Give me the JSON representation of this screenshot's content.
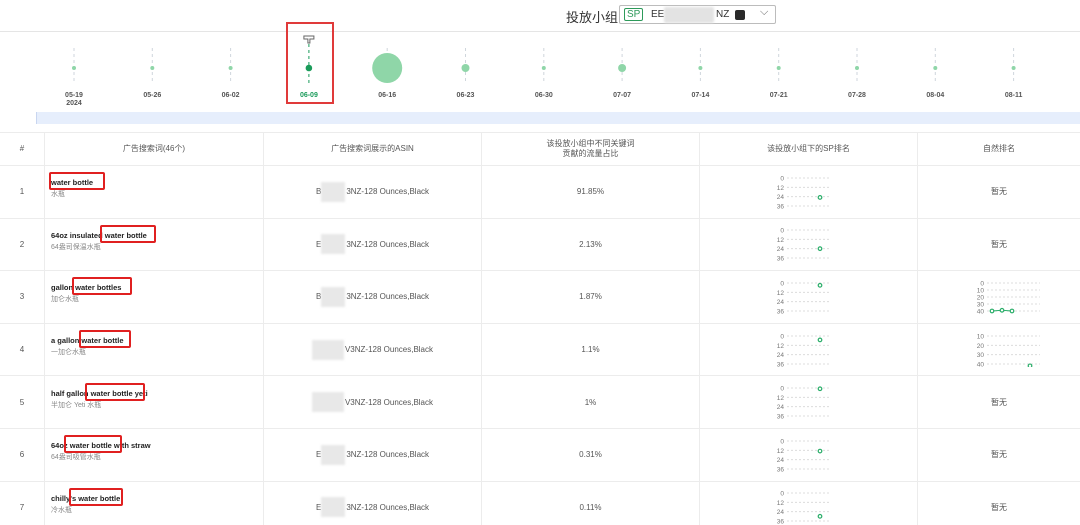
{
  "header": {
    "group_label": "投放小组",
    "badge": "SP",
    "group_name_prefix": "EE",
    "group_name_suffix": "NZ"
  },
  "timeline": {
    "dates": [
      "05-19",
      "05-26",
      "06-02",
      "06-09",
      "06-16",
      "06-23",
      "06-30",
      "07-07",
      "07-14",
      "07-21",
      "07-28",
      "08-04",
      "08-11"
    ],
    "year_label": "2024",
    "selected_index": 3,
    "selected_color": "#1a9b5a",
    "bubble_color": "#8fd6a8",
    "bubble_sizes": [
      1,
      0,
      0,
      2,
      12,
      3,
      1,
      3,
      0,
      1,
      1,
      1,
      1
    ]
  },
  "table": {
    "headers": {
      "index": "#",
      "keyword": "广告搜索词(46个)",
      "asin": "广告搜索词展示的ASIN",
      "traffic": "该投放小组中不同关键词\n贡献的流量占比",
      "sp_rank": "该投放小组下的SP排名",
      "natural_rank": "自然排名"
    },
    "rows": [
      {
        "index": "1",
        "keyword": "water bottle",
        "translation": "水瓶",
        "asin_prefix": "B",
        "asin_suffix": "3NZ-128 Ounces,Black",
        "traffic": "91.85%",
        "sp_rank": [
          25
        ],
        "natural_rank": "暂无"
      },
      {
        "index": "2",
        "keyword": "64oz insulated water bottle",
        "translation": "64盎司保温水瓶",
        "asin_prefix": "E",
        "asin_suffix": "3NZ-128 Ounces,Black",
        "traffic": "2.13%",
        "sp_rank": [
          24
        ],
        "natural_rank": "暂无"
      },
      {
        "index": "3",
        "keyword": "gallon water bottles",
        "translation": "加仑水瓶",
        "asin_prefix": "B",
        "asin_suffix": "3NZ-128 Ounces,Black",
        "traffic": "1.87%",
        "sp_rank": [
          3
        ],
        "natural_rank": "",
        "natural_rank_series": [
          40,
          39,
          40
        ]
      },
      {
        "index": "4",
        "keyword": "a gallon water bottle",
        "translation": "一加仑水瓶",
        "asin_prefix": "",
        "asin_suffix": "V3NZ-128 Ounces,Black",
        "traffic": "1.1%",
        "sp_rank": [
          5
        ],
        "natural_rank": "",
        "natural_rank_series": [
          42
        ]
      },
      {
        "index": "5",
        "keyword": "half gallon water bottle yeti",
        "translation": "半加仑 Yeti 水瓶",
        "asin_prefix": "",
        "asin_suffix": "V3NZ-128 Ounces,Black",
        "traffic": "1%",
        "sp_rank": [
          1
        ],
        "natural_rank": "暂无"
      },
      {
        "index": "6",
        "keyword": "64oz water bottle with straw",
        "translation": "64盎司吸管水瓶",
        "asin_prefix": "E",
        "asin_suffix": "3NZ-128 Ounces,Black",
        "traffic": "0.31%",
        "sp_rank": [
          13
        ],
        "natural_rank": "暂无"
      },
      {
        "index": "7",
        "keyword": "chilly's water bottle",
        "translation": "冷水瓶",
        "asin_prefix": "E",
        "asin_suffix": "3NZ-128 Ounces,Black",
        "traffic": "0.11%",
        "sp_rank": [
          30
        ],
        "natural_rank": "暂无"
      }
    ]
  },
  "sp_ticks": [
    "0",
    "12",
    "24",
    "36"
  ],
  "nat_ticks": [
    "0",
    "10",
    "20",
    "30",
    "40"
  ],
  "nat_ticks_short": [
    "10",
    "20",
    "30",
    "40"
  ],
  "colors": {
    "green": "#2bae6a",
    "red_box": "#e02020"
  }
}
